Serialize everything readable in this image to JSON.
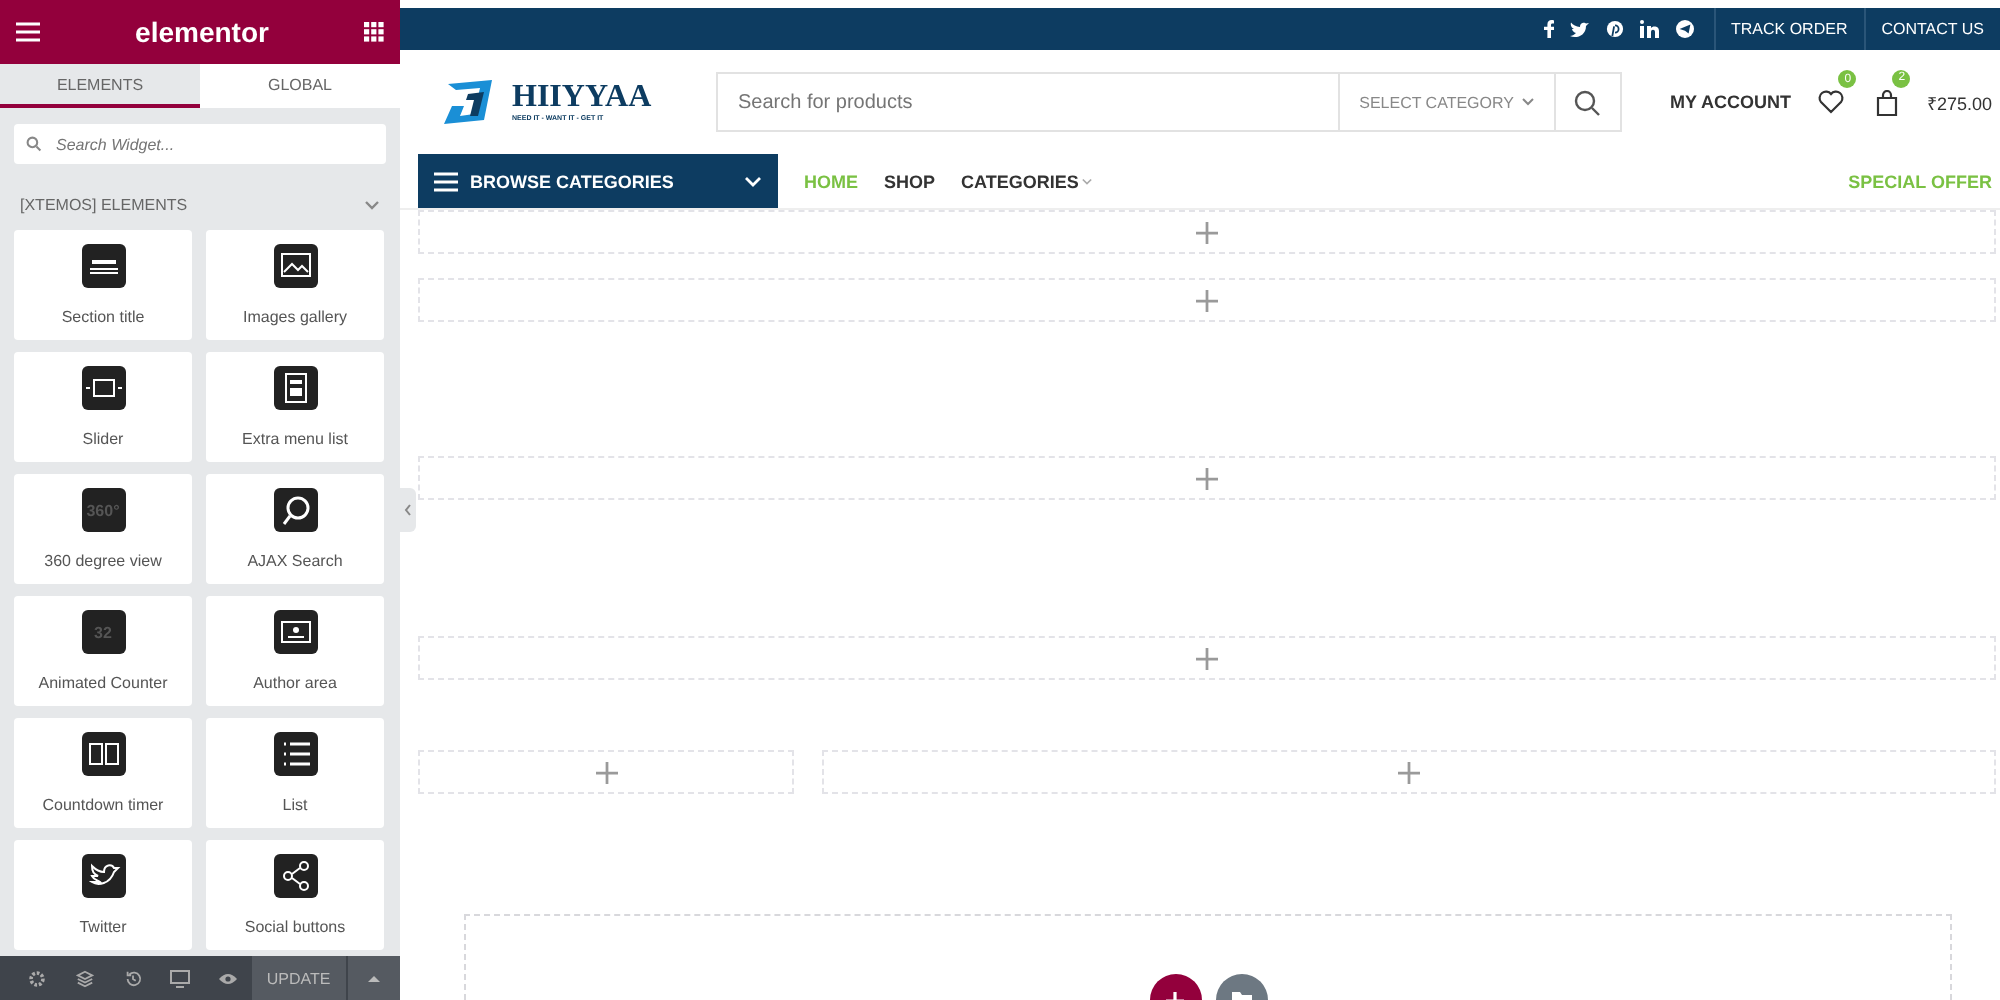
{
  "editor": {
    "logo": "elementor",
    "tabs": [
      {
        "label": "ELEMENTS",
        "selected": true
      },
      {
        "label": "GLOBAL",
        "selected": false
      }
    ],
    "search": {
      "placeholder": "Search Widget..."
    },
    "category": {
      "title": "[XTEMOS] ELEMENTS",
      "expanded": true
    },
    "widgets": [
      {
        "label": "Section title"
      },
      {
        "label": "Images gallery"
      },
      {
        "label": "Slider"
      },
      {
        "label": "Extra menu list"
      },
      {
        "label": "360 degree view",
        "icon_text": "360°"
      },
      {
        "label": "AJAX Search"
      },
      {
        "label": "Animated Counter",
        "icon_text": "32"
      },
      {
        "label": "Author area"
      },
      {
        "label": "Countdown timer"
      },
      {
        "label": "List"
      },
      {
        "label": "Twitter"
      },
      {
        "label": "Social buttons"
      }
    ],
    "update_button": "UPDATE"
  },
  "site": {
    "topbar_links": [
      "TRACK ORDER",
      "CONTACT US"
    ],
    "logo_name": "HIIYYAA",
    "logo_tagline": "NEED IT - WANT IT - GET IT",
    "search": {
      "placeholder": "Search for products"
    },
    "category_select": "SELECT CATEGORY",
    "account": "MY ACCOUNT",
    "wishlist_count": "0",
    "cart_count": "2",
    "cart_total": "₹275.00",
    "browse": "BROWSE CATEGORIES",
    "nav": [
      {
        "label": "HOME",
        "selected": true,
        "dropdown": false
      },
      {
        "label": "SHOP",
        "selected": false,
        "dropdown": false
      },
      {
        "label": "CATEGORIES",
        "selected": false,
        "dropdown": true
      }
    ],
    "special_offer": "SPECIAL OFFER"
  }
}
